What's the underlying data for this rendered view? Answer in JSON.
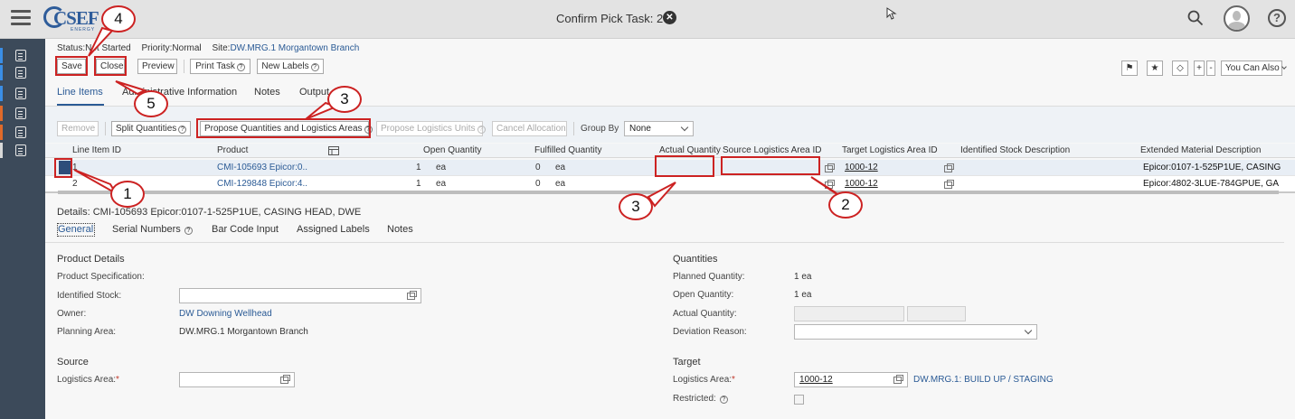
{
  "header": {
    "logo_text": "CSEF",
    "logo_sub": "ENERGY",
    "title": "Confirm Pick Task: 2",
    "close_glyph": "✕"
  },
  "sidebar": {
    "items": [
      {
        "icon": "clipboard-icon",
        "accent": "#3a8ee6"
      },
      {
        "icon": "clipboard-list-icon",
        "accent": "#3a8ee6"
      },
      {
        "icon": "car-icon",
        "accent": "#3a8ee6"
      },
      {
        "icon": "truck-icon",
        "accent": "#e06a2a"
      },
      {
        "icon": "truck-return-icon",
        "accent": "#e06a2a"
      },
      {
        "icon": "puzzle-icon",
        "accent": "#d8d8d8"
      }
    ]
  },
  "status": {
    "status_label": "Status:",
    "status_value": "Not Started",
    "priority_label": "Priority:",
    "priority_value": "Normal",
    "site_label": "Site:",
    "site_value": "DW.MRG.1 Morgantown Branch"
  },
  "toolbar": {
    "save": "Save",
    "close": "Close",
    "preview": "Preview",
    "print_task": "Print Task",
    "new_labels": "New Labels",
    "you_can_also": "You Can Also"
  },
  "tabs": [
    "Line Items",
    "Administrative Information",
    "Notes",
    "Output"
  ],
  "grid_toolbar": {
    "remove": "Remove",
    "split_quantities": "Split Quantities",
    "propose_quantities": "Propose Quantities and Logistics Areas",
    "propose_units": "Propose Logistics Units",
    "cancel_allocation": "Cancel Allocation",
    "group_by_label": "Group By",
    "group_by_value": "None"
  },
  "grid": {
    "headers": {
      "line_item_id": "Line Item ID",
      "product": "Product",
      "open_quantity": "Open Quantity",
      "fulfilled_quantity": "Fulfilled Quantity",
      "actual_quantity": "Actual Quantity",
      "source_area": "Source Logistics Area ID",
      "target_area": "Target Logistics Area ID",
      "identified_stock": "Identified Stock Description",
      "extended_desc": "Extended Material Description"
    },
    "rows": [
      {
        "id": "1",
        "product": "CMI-105693 Epicor:0...",
        "open_qty": "1",
        "open_unit": "ea",
        "fulfilled_qty": "0",
        "fulfilled_unit": "ea",
        "target": "1000-12",
        "ext_desc": "Epicor:0107-1-525P1UE, CASING"
      },
      {
        "id": "2",
        "product": "CMI-129848 Epicor:4...",
        "open_qty": "1",
        "open_unit": "ea",
        "fulfilled_qty": "0",
        "fulfilled_unit": "ea",
        "target": "1000-12",
        "ext_desc": "Epicor:4802-3LUE-784GPUE, GA"
      }
    ]
  },
  "details": {
    "title": "Details: CMI-105693 Epicor:0107-1-525P1UE, CASING HEAD, DWE",
    "tabs": [
      "General",
      "Serial Numbers",
      "Bar Code Input",
      "Assigned Labels",
      "Notes"
    ],
    "product_details": {
      "heading": "Product Details",
      "product_spec_label": "Product Specification:",
      "identified_stock_label": "Identified Stock:",
      "owner_label": "Owner:",
      "owner_value": "DW Downing Wellhead",
      "planning_area_label": "Planning Area:",
      "planning_area_value": "DW.MRG.1 Morgantown Branch"
    },
    "quantities": {
      "heading": "Quantities",
      "planned_label": "Planned Quantity:",
      "planned_value": "1 ea",
      "open_label": "Open Quantity:",
      "open_value": "1 ea",
      "actual_label": "Actual Quantity:",
      "deviation_label": "Deviation Reason:"
    },
    "source": {
      "heading": "Source",
      "logistics_area_label": "Logistics Area:",
      "required_mark": "*"
    },
    "target": {
      "heading": "Target",
      "logistics_area_label": "Logistics Area:",
      "required_mark": "*",
      "logistics_area_value": "1000-12",
      "logistics_area_desc": "DW.MRG.1: BUILD UP / STAGING",
      "restricted_label": "Restricted:"
    }
  },
  "annotations": {
    "callouts": [
      "1",
      "2",
      "3",
      "3",
      "4",
      "5"
    ],
    "color": "#cc2222"
  }
}
